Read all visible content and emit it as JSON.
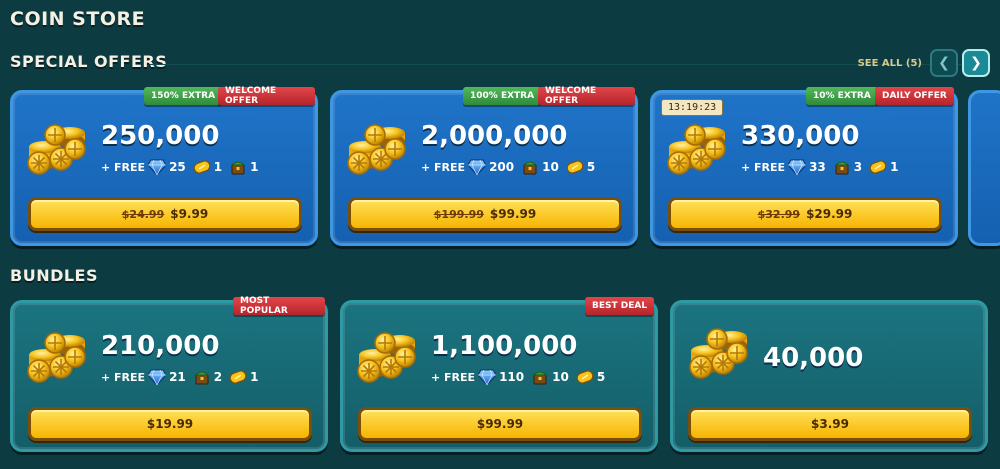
{
  "header": {
    "title": "COIN STORE"
  },
  "special": {
    "title": "SPECIAL OFFERS",
    "see_all": "SEE ALL (5)",
    "cards": [
      {
        "badges": [
          {
            "text": "150% EXTRA",
            "color": "green"
          },
          {
            "text": "WELCOME OFFER",
            "color": "red"
          }
        ],
        "amount": "250,000",
        "free_label": "+ FREE",
        "items": [
          {
            "icon": "gem-icon",
            "value": "25"
          },
          {
            "icon": "ticket-icon",
            "value": "1"
          },
          {
            "icon": "chest-icon",
            "value": "1"
          }
        ],
        "old_price": "$24.99",
        "price": "$9.99"
      },
      {
        "badges": [
          {
            "text": "100% EXTRA",
            "color": "green"
          },
          {
            "text": "WELCOME OFFER",
            "color": "red"
          }
        ],
        "amount": "2,000,000",
        "free_label": "+ FREE",
        "items": [
          {
            "icon": "gem-icon",
            "value": "200"
          },
          {
            "icon": "chest-icon",
            "value": "10"
          },
          {
            "icon": "ticket-icon",
            "value": "5"
          }
        ],
        "old_price": "$199.99",
        "price": "$99.99"
      },
      {
        "timer": "13:19:23",
        "badges": [
          {
            "text": "10% EXTRA",
            "color": "green"
          },
          {
            "text": "DAILY OFFER",
            "color": "red"
          }
        ],
        "amount": "330,000",
        "free_label": "+ FREE",
        "items": [
          {
            "icon": "gem-icon",
            "value": "33"
          },
          {
            "icon": "chest-icon",
            "value": "3"
          },
          {
            "icon": "ticket-icon",
            "value": "1"
          }
        ],
        "old_price": "$32.99",
        "price": "$29.99"
      }
    ]
  },
  "bundles": {
    "title": "BUNDLES",
    "cards": [
      {
        "badge": "MOST POPULAR",
        "amount": "210,000",
        "free_label": "+ FREE",
        "items": [
          {
            "icon": "gem-icon",
            "value": "21"
          },
          {
            "icon": "chest-icon",
            "value": "2"
          },
          {
            "icon": "ticket-icon",
            "value": "1"
          }
        ],
        "price": "$19.99"
      },
      {
        "badge": "BEST DEAL",
        "amount": "1,100,000",
        "free_label": "+ FREE",
        "items": [
          {
            "icon": "gem-icon",
            "value": "110"
          },
          {
            "icon": "chest-icon",
            "value": "10"
          },
          {
            "icon": "ticket-icon",
            "value": "5"
          }
        ],
        "price": "$99.99"
      },
      {
        "amount": "40,000",
        "price": "$3.99"
      }
    ]
  },
  "colors": {
    "background": "#0c3b42",
    "offer_card": "#1a6abd",
    "bundle_card": "#17697a",
    "price_button": "#fcc515",
    "badge_green": "#3ea24a",
    "badge_red": "#c8343a"
  }
}
